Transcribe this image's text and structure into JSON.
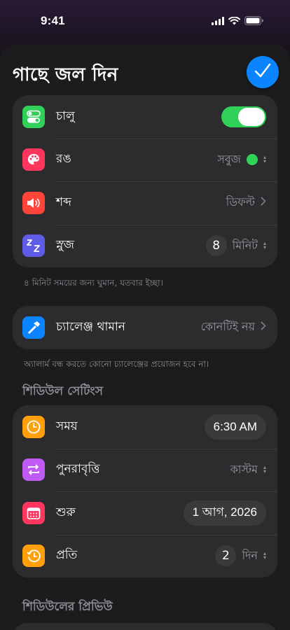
{
  "status": {
    "time": "9:41"
  },
  "sheet": {
    "title": "গাছে জল দিন"
  },
  "alarm": {
    "enabled_label": "চালু",
    "enabled": true,
    "color_label": "রঙ",
    "color_value": "সবুজ",
    "color_hex": "#30d158",
    "sound_label": "শব্দ",
    "sound_value": "ডিফল্ট",
    "snooze_label": "স্নুজ",
    "snooze_number": "8",
    "snooze_unit": "মিনিট"
  },
  "snooze_footnote": "৪ মিনিট সময়ের জন্য ঘুমান, যতবার ইচ্ছা।",
  "challenge": {
    "label": "চ্যালেঞ্জ থামান",
    "value": "কোনটিই নয়"
  },
  "challenge_footnote": "অ্যালার্ম বন্ধ করতে কোনো চ্যালেঞ্জের প্রয়োজন হবে না।",
  "schedule": {
    "header": "শিডিউল সেটিংস",
    "time_label": "সময়",
    "time_value": "6:30 AM",
    "repeat_label": "পুনরাবৃত্তি",
    "repeat_value": "কাস্টম",
    "start_label": "শুরু",
    "start_value": "1 আগ, 2026",
    "every_label": "প্রতি",
    "every_number": "2",
    "every_unit": "দিন"
  },
  "preview": {
    "header": "শিডিউলের প্রিভিউ"
  },
  "colors": {
    "accent": "#0a84ff",
    "green": "#30d158",
    "palette_icon": "#ff375f",
    "sound_icon": "#ff453a",
    "snooze_icon": "#5e5ce6",
    "challenge_icon": "#0a84ff",
    "time_icon": "#ff9f0a",
    "repeat_icon": "#bf5af2",
    "start_icon": "#ff375f",
    "every_icon": "#ff9f0a"
  }
}
